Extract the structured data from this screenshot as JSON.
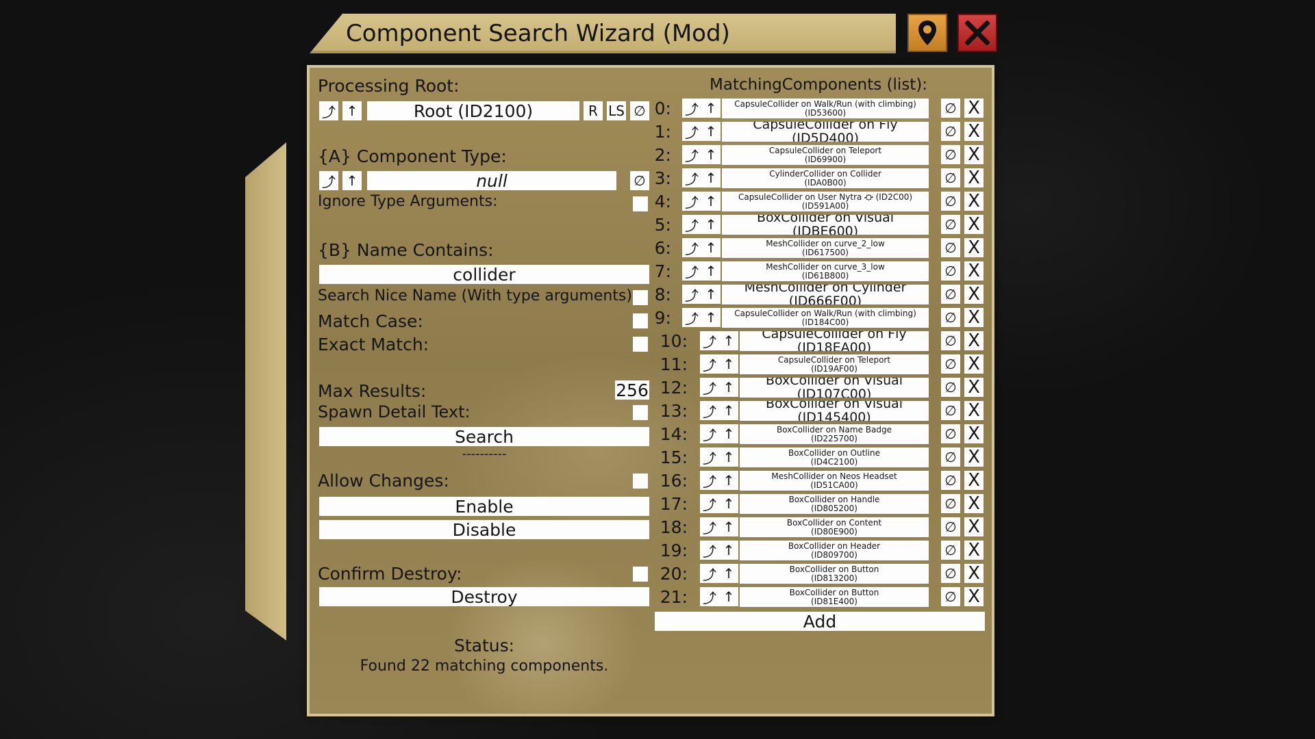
{
  "title": "Component Search Wizard (Mod)",
  "header_buttons": {
    "locate_icon": "map-pin-icon",
    "close_icon": "close-x-icon"
  },
  "left": {
    "processing_root_label": "Processing Root:",
    "root_value": "Root (ID2100)",
    "root_r": "R",
    "root_ls": "LS",
    "component_type_label": "{A} Component Type:",
    "component_type_value": "null",
    "ignore_type_args_label": "Ignore Type Arguments:",
    "name_contains_label": "{B} Name Contains:",
    "name_contains_value": "collider",
    "search_nice_name_label": "Search Nice Name (With type arguments):",
    "match_case_label": "Match Case:",
    "exact_match_label": "Exact Match:",
    "max_results_label": "Max Results:",
    "max_results_value": "256",
    "spawn_detail_label": "Spawn Detail Text:",
    "search_button": "Search",
    "divider_text": "----------",
    "allow_changes_label": "Allow Changes:",
    "enable_button": "Enable",
    "disable_button": "Disable",
    "confirm_destroy_label": "Confirm Destroy:",
    "destroy_button": "Destroy",
    "status_label": "Status:",
    "status_value": "Found 22 matching components."
  },
  "glyphs": {
    "jump": "⤴",
    "up": "↑",
    "null": "∅",
    "remove": "X"
  },
  "right": {
    "list_label": "MatchingComponents (list):",
    "add_button": "Add",
    "items": [
      {
        "index": "0:",
        "line1": "CapsuleCollider on Walk/Run (with climbing)",
        "line2": "(ID53600)"
      },
      {
        "index": "1:",
        "line1": "CapsuleCollider on Fly (ID5D400)",
        "line2": ""
      },
      {
        "index": "2:",
        "line1": "CapsuleCollider on Teleport",
        "line2": "(ID69900)"
      },
      {
        "index": "3:",
        "line1": "CylinderCollider on Collider",
        "line2": "(IDA0B00)"
      },
      {
        "index": "4:",
        "line1": "CapsuleCollider on User Nytra ⛮ (ID2C00)",
        "line2": "(ID591A00)"
      },
      {
        "index": "5:",
        "line1": "BoxCollider on Visual (IDBE600)",
        "line2": ""
      },
      {
        "index": "6:",
        "line1": "MeshCollider on curve_2_low",
        "line2": "(ID617500)"
      },
      {
        "index": "7:",
        "line1": "MeshCollider on curve_3_low",
        "line2": "(ID61B800)"
      },
      {
        "index": "8:",
        "line1": "MeshCollider on Cylinder (ID666F00)",
        "line2": ""
      },
      {
        "index": "9:",
        "line1": "CapsuleCollider on Walk/Run (with climbing)",
        "line2": "(ID184C00)"
      },
      {
        "index": "10:",
        "line1": "CapsuleCollider on Fly (ID18EA00)",
        "line2": ""
      },
      {
        "index": "11:",
        "line1": "CapsuleCollider on Teleport",
        "line2": "(ID19AF00)"
      },
      {
        "index": "12:",
        "line1": "BoxCollider on Visual (ID107C00)",
        "line2": ""
      },
      {
        "index": "13:",
        "line1": "BoxCollider on Visual (ID145400)",
        "line2": ""
      },
      {
        "index": "14:",
        "line1": "BoxCollider on Name Badge",
        "line2": "(ID225700)"
      },
      {
        "index": "15:",
        "line1": "BoxCollider on Outline",
        "line2": "(ID4C2100)"
      },
      {
        "index": "16:",
        "line1": "MeshCollider on Neos Headset",
        "line2": "(ID51CA00)"
      },
      {
        "index": "17:",
        "line1": "BoxCollider on Handle",
        "line2": "(ID805200)"
      },
      {
        "index": "18:",
        "line1": "BoxCollider on Content",
        "line2": "(ID80E900)"
      },
      {
        "index": "19:",
        "line1": "BoxCollider on Header",
        "line2": "(ID809700)"
      },
      {
        "index": "20:",
        "line1": "BoxCollider on Button",
        "line2": "(ID813200)"
      },
      {
        "index": "21:",
        "line1": "BoxCollider on Button",
        "line2": "(ID81E400)"
      }
    ]
  }
}
